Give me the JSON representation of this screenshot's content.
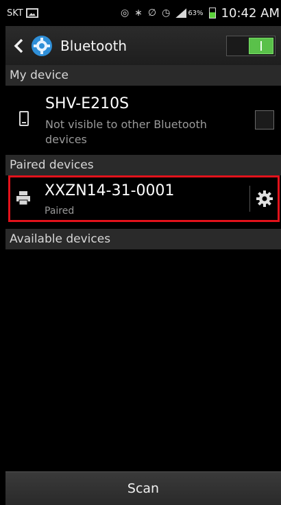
{
  "status_bar": {
    "carrier": "SKT",
    "battery_percent": "63%",
    "time": "10:42 AM"
  },
  "action_bar": {
    "title": "Bluetooth",
    "toggle_on": true
  },
  "sections": {
    "my_device": "My device",
    "paired_devices": "Paired devices",
    "available_devices": "Available devices"
  },
  "my_device": {
    "name": "SHV-E210S",
    "status": "Not visible to other Bluetooth devices"
  },
  "paired": [
    {
      "name": "XXZN14-31-0001",
      "status": "Paired"
    }
  ],
  "bottom": {
    "scan_label": "Scan"
  },
  "colors": {
    "accent_green": "#5ac14a",
    "highlight_red": "#e3121b",
    "gear_blue": "#2f8fd8"
  },
  "icons": [
    "image-icon",
    "eye-icon",
    "bluetooth-icon",
    "mute-icon",
    "alarm-icon",
    "signal-icon",
    "battery-icon",
    "back-icon",
    "settings-gear-icon",
    "phone-icon",
    "printer-icon",
    "gear-icon"
  ]
}
